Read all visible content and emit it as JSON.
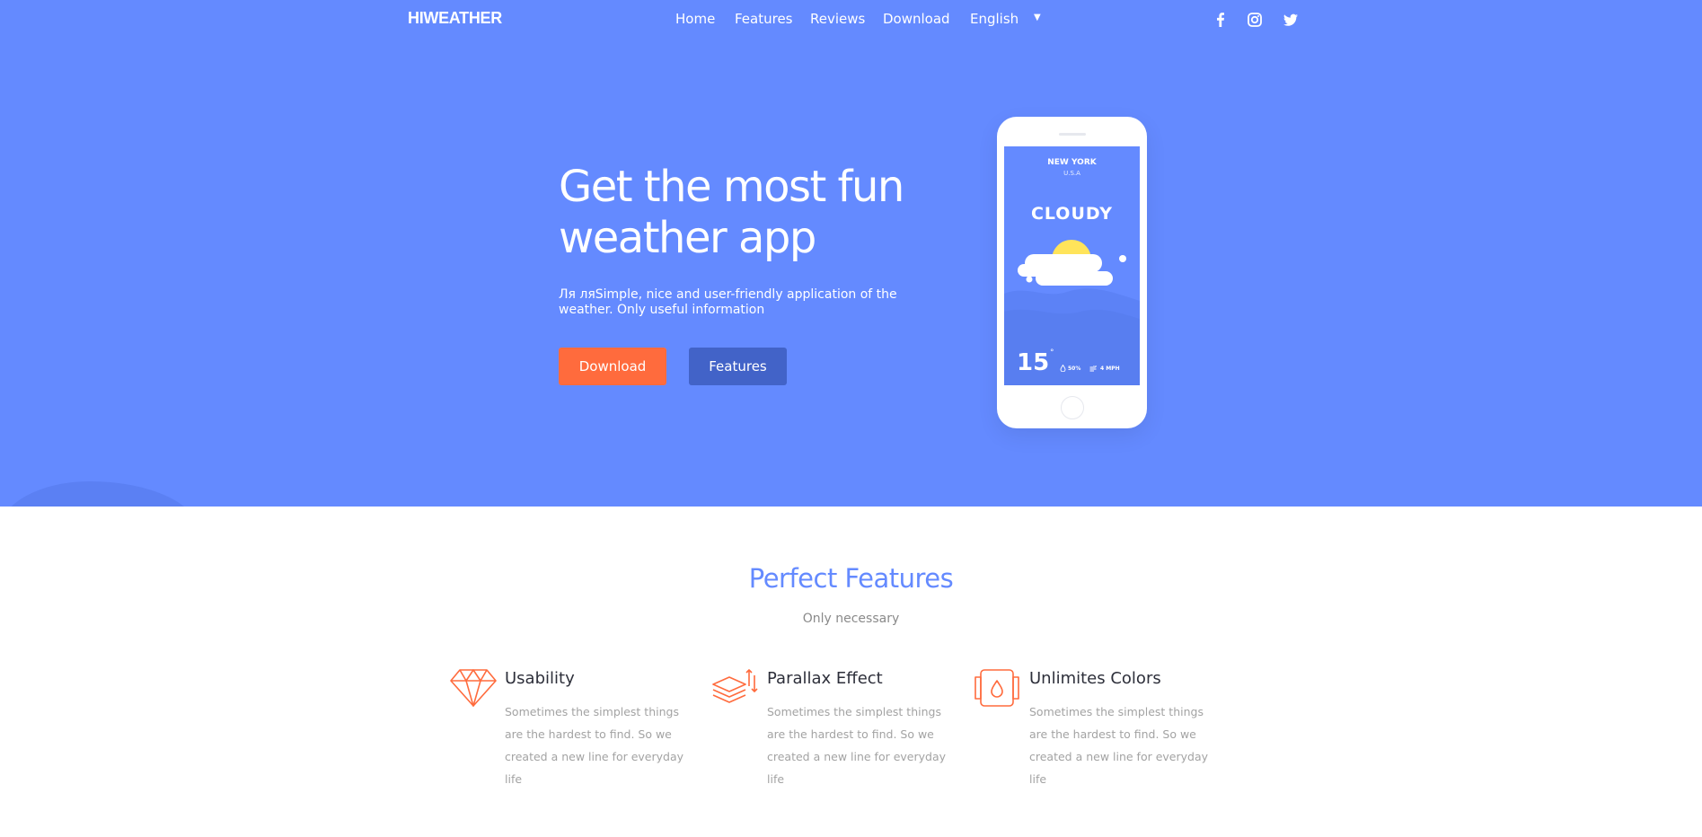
{
  "brand": {
    "logo": "HIWEATHER"
  },
  "nav": {
    "links": [
      "Home",
      "Features",
      "Reviews",
      "Download"
    ],
    "language": "English",
    "social": [
      "facebook-icon",
      "instagram-icon",
      "twitter-icon"
    ]
  },
  "hero": {
    "title_line1": "Get the most fun",
    "title_line2": "weather app",
    "subtitle": "Ля ляSimple, nice and user-friendly application of the weather. Only useful information",
    "download_label": "Download",
    "features_label": "Features"
  },
  "phone": {
    "city": "NEW YORK",
    "country": "U.S.A",
    "condition": "CLOUDY",
    "temperature": "15",
    "degree": "°",
    "humidity": "50%",
    "wind": "4 MPH"
  },
  "features": {
    "title": "Perfect Features",
    "subtitle": "Only necessary",
    "items": [
      {
        "icon": "diamond-icon",
        "title": "Usability",
        "text": "Sometimes the simplest things are the hardest to find. So we created a new line for everyday life"
      },
      {
        "icon": "layers-icon",
        "title": "Parallax Effect",
        "text": "Sometimes the simplest things are the hardest to find. So we created a new line for everyday life"
      },
      {
        "icon": "color-drop-icon",
        "title": "Unlimites Colors",
        "text": "Sometimes the simplest things are the hardest to find. So we created a new line for everyday life"
      }
    ]
  },
  "colors": {
    "hero_bg": "#648aff",
    "accent_orange": "#ff6b3d",
    "button_blue": "#4263c8",
    "sun_yellow": "#ffe45a"
  }
}
